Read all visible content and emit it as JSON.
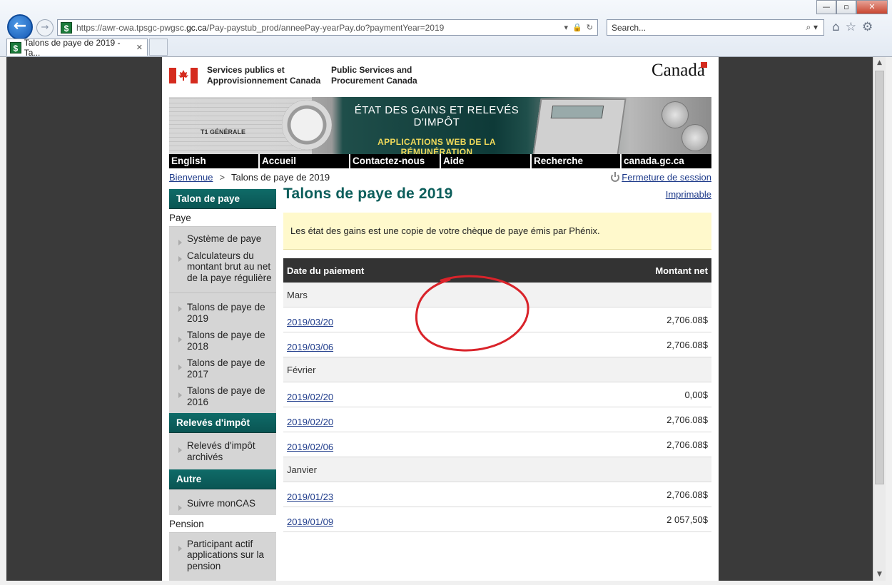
{
  "browser": {
    "url_prefix": "https://awr-cwa.tpsgc-pwgsc.",
    "url_domain": "gc.ca",
    "url_path": "/Pay-paystub_prod/anneePay-yearPay.do?paymentYear=2019",
    "search_placeholder": "Search...",
    "tab_title": "Talons de paye de 2019 - Ta...",
    "tab_close": "✕",
    "favicon": "$"
  },
  "header": {
    "dept_fr_line1": "Services publics et",
    "dept_fr_line2": "Approvisionnement Canada",
    "dept_en_line1": "Public Services and",
    "dept_en_line2": "Procurement Canada",
    "wordmark": "Canada"
  },
  "banner": {
    "title_line1": "ÉTAT DES GAINS ET RELEVÉS",
    "title_line2": "D'IMPÔT",
    "subtitle": "APPLICATIONS WEB DE LA RÉMUNÉRATION",
    "t1_label": "T1 GÉNÉRALE"
  },
  "nav": [
    "English",
    "Accueil",
    "Contactez-nous",
    "Aide",
    "Recherche",
    "canada.gc.ca"
  ],
  "breadcrumb": {
    "home": "Bienvenue",
    "separator": ">",
    "current": "Talons de paye de 2019"
  },
  "logout": "Fermeture de session",
  "sidebar": {
    "section1": "Talon de paye",
    "sub_paye": "Paye",
    "paye_items": [
      "Système de paye",
      "Calculateurs du montant brut au net de la paye régulière"
    ],
    "year_items": [
      "Talons de paye de 2019",
      "Talons de paye de 2018",
      "Talons de paye de 2017",
      "Talons de paye de 2016"
    ],
    "section2": "Relevés d'impôt",
    "tax_items": [
      "Relevés d'impôt archivés"
    ],
    "section3": "Autre",
    "other_items": [
      "Suivre monCAS"
    ],
    "sub_pension": "Pension",
    "pension_items": [
      "Participant actif applications sur la pension"
    ]
  },
  "main": {
    "title": "Talons de paye de 2019",
    "printable": "Imprimable",
    "notice": "Les état des gains est une copie de votre chèque de paye émis par Phénix.",
    "table": {
      "col_date": "Date du paiement",
      "col_amount": "Montant net",
      "groups": [
        {
          "month": "Mars",
          "rows": [
            {
              "date": "2019/03/20",
              "amount": "2,706.08$"
            },
            {
              "date": "2019/03/06",
              "amount": "2,706.08$"
            }
          ]
        },
        {
          "month": "Février",
          "rows": [
            {
              "date": "2019/02/20",
              "amount": "0,00$"
            },
            {
              "date": "2019/02/20",
              "amount": "2,706.08$"
            },
            {
              "date": "2019/02/06",
              "amount": "2,706.08$"
            }
          ]
        },
        {
          "month": "Janvier",
          "rows": [
            {
              "date": "2019/01/23",
              "amount": "2,706.08$"
            },
            {
              "date": "2019/01/09",
              "amount": "2 057,50$"
            }
          ]
        }
      ]
    }
  },
  "colors": {
    "teal": "#0c5e5b",
    "link": "#1d3a8a",
    "notice_bg": "#fff9cc",
    "circle": "#d9232a"
  }
}
